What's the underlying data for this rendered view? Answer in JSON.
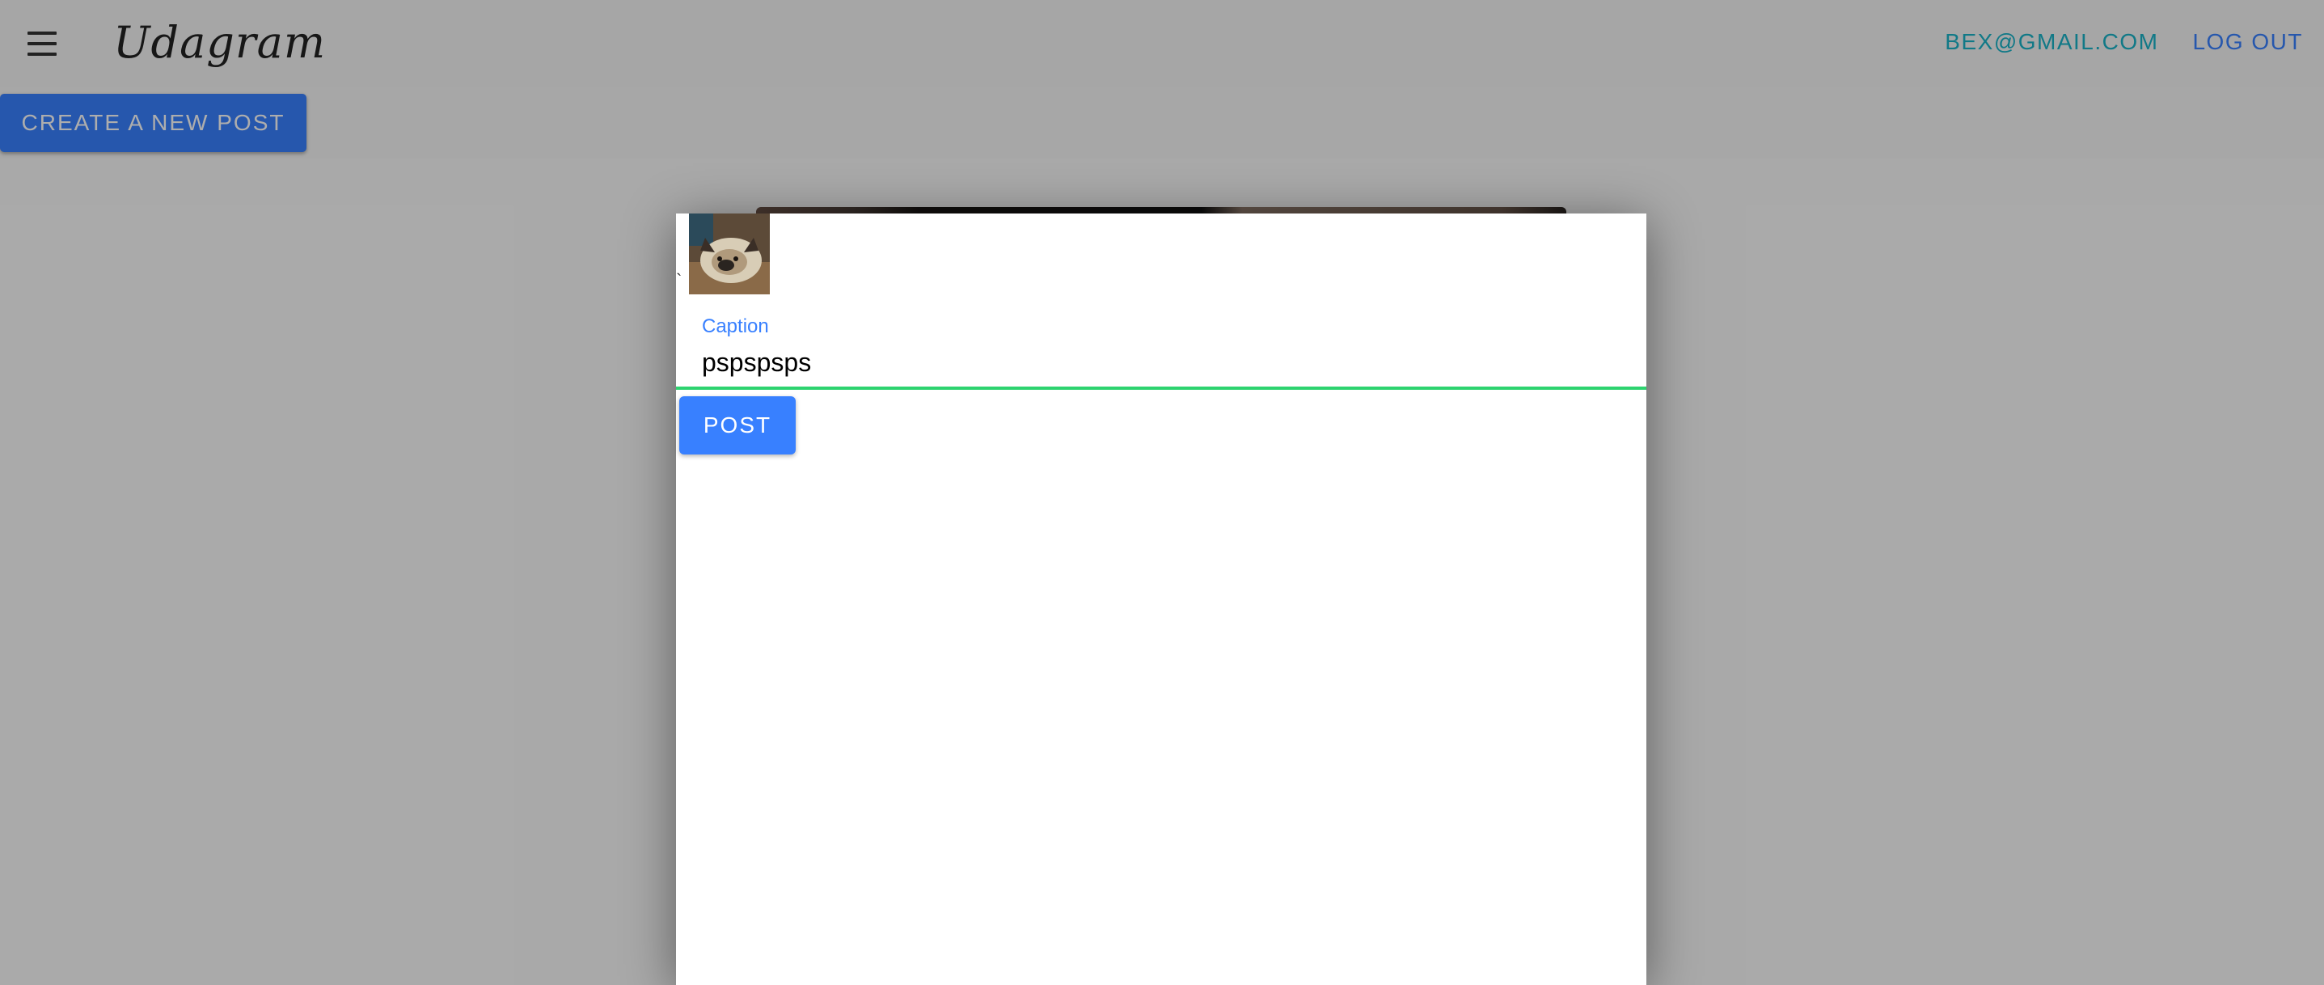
{
  "header": {
    "app_title": "Udagram",
    "user_email": "BEX@GMAIL.COM",
    "logout_label": "LOG OUT"
  },
  "actions": {
    "create_post_label": "CREATE A NEW POST"
  },
  "modal": {
    "stray_mark": "`",
    "caption_label": "Caption",
    "caption_value": "pspspsps",
    "post_label": "POST"
  },
  "icons": {
    "menu": "hamburger-menu-icon"
  },
  "colors": {
    "primary": "#3880ff",
    "email_link": "#1ab3c8",
    "input_focus_underline": "#2dd36f",
    "backdrop": "rgba(0,0,0,0.32)"
  }
}
